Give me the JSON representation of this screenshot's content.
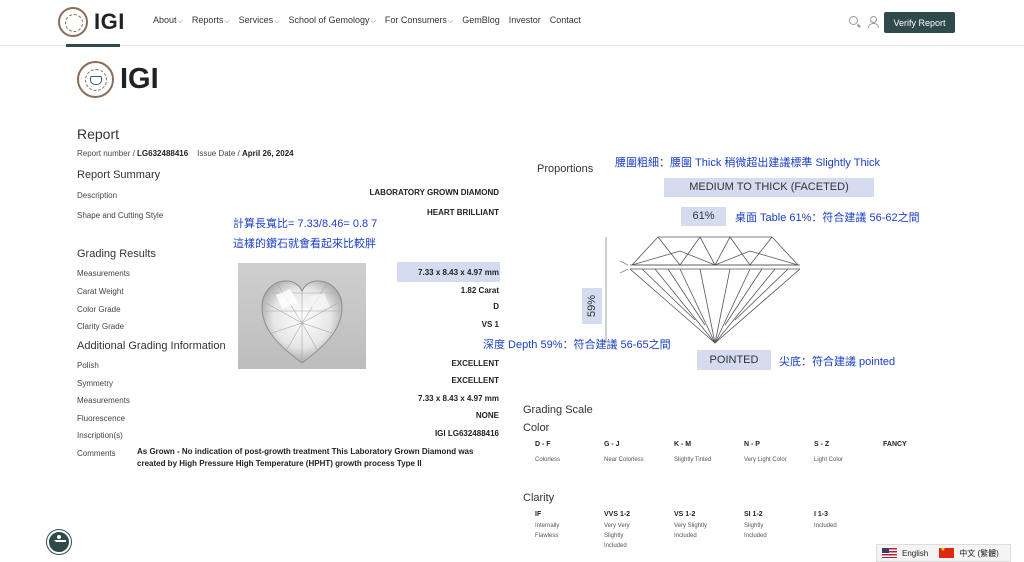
{
  "nav": {
    "logo": "IGI",
    "menu": [
      {
        "label": "About",
        "dropdown": true
      },
      {
        "label": "Reports",
        "dropdown": true
      },
      {
        "label": "Services",
        "dropdown": true
      },
      {
        "label": "School of Gemology",
        "dropdown": true
      },
      {
        "label": "For Consumers",
        "dropdown": true
      },
      {
        "label": "GemBlog",
        "dropdown": false
      },
      {
        "label": "Investor",
        "dropdown": false
      },
      {
        "label": "Contact",
        "dropdown": false
      }
    ],
    "verify_label": "Verify Report"
  },
  "report": {
    "logo": "IGI",
    "title": "Report",
    "number_label": "Report number /",
    "number": "LG632488416",
    "issue_label": "Issue Date /",
    "issue_date": "April 26, 2024"
  },
  "summary": {
    "heading": "Report Summary",
    "rows": [
      {
        "label": "Description",
        "value": "LABORATORY GROWN DIAMOND"
      },
      {
        "label": "Shape and Cutting Style",
        "value": "HEART BRILLIANT"
      }
    ]
  },
  "grading": {
    "heading": "Grading Results",
    "rows": [
      {
        "label": "Measurements",
        "value": "7.33 x 8.43 x 4.97 mm"
      },
      {
        "label": "Carat Weight",
        "value": "1.82 Carat"
      },
      {
        "label": "Color Grade",
        "value": "D"
      },
      {
        "label": "Clarity Grade",
        "value": "VS 1"
      }
    ]
  },
  "additional": {
    "heading": "Additional Grading Information",
    "rows": [
      {
        "label": "Polish",
        "value": "EXCELLENT"
      },
      {
        "label": "Symmetry",
        "value": "EXCELLENT"
      },
      {
        "label": "Measurements",
        "value": "7.33 x 8.43 x 4.97 mm"
      },
      {
        "label": "Fluorescence",
        "value": "NONE"
      },
      {
        "label": "Inscription(s)",
        "value": "IGI LG632488416"
      }
    ],
    "comments_label": "Comments",
    "comments": "As Grown - No indication of post-growth treatment This Laboratory Grown Diamond was created by High Pressure High Temperature (HPHT) growth process Type II"
  },
  "annotations": {
    "ratio_line1": "計算長寬比= 7.33/8.46= 0.8 7",
    "ratio_line2": "這樣的鑽石就會看起來比較胖",
    "girdle": "腰圍粗細：腰圍 Thick 稍微超出建議標準 Slightly Thick",
    "table": "桌面 Table 61%：符合建議 56-62之間",
    "depth": "深度 Depth 59%：符合建議 56-65之間",
    "culet": "尖底：符合建議 pointed"
  },
  "proportions": {
    "heading": "Proportions",
    "girdle": "MEDIUM TO THICK (FACETED)",
    "table": "61%",
    "depth": "59%",
    "culet": "POINTED"
  },
  "grading_scale": {
    "heading": "Grading Scale",
    "color_heading": "Color",
    "color": [
      {
        "grade": "D - F",
        "desc": "Colorless"
      },
      {
        "grade": "G - J",
        "desc": "Near Colorless"
      },
      {
        "grade": "K - M",
        "desc": "Slightly Tinted"
      },
      {
        "grade": "N - P",
        "desc": "Very Light Color"
      },
      {
        "grade": "S - Z",
        "desc": "Light Color"
      },
      {
        "grade": "FANCY",
        "desc": ""
      }
    ],
    "clarity_heading": "Clarity",
    "clarity": [
      {
        "grade": "IF",
        "desc": [
          "Internally",
          "Flawless"
        ]
      },
      {
        "grade": "VVS 1-2",
        "desc": [
          "Very Very",
          "Slightly",
          "Included"
        ]
      },
      {
        "grade": "VS 1-2",
        "desc": [
          "Very Slightly",
          "Included"
        ]
      },
      {
        "grade": "SI 1-2",
        "desc": [
          "Slightly",
          "Included"
        ]
      },
      {
        "grade": "I 1-3",
        "desc": [
          "Included"
        ]
      }
    ]
  },
  "language": {
    "english": "English",
    "chinese": "中文 (繁體)"
  },
  "colors": {
    "brand": "#2f4a4a",
    "highlight": "#d6dcf0",
    "annotation": "#1a3fc8"
  }
}
